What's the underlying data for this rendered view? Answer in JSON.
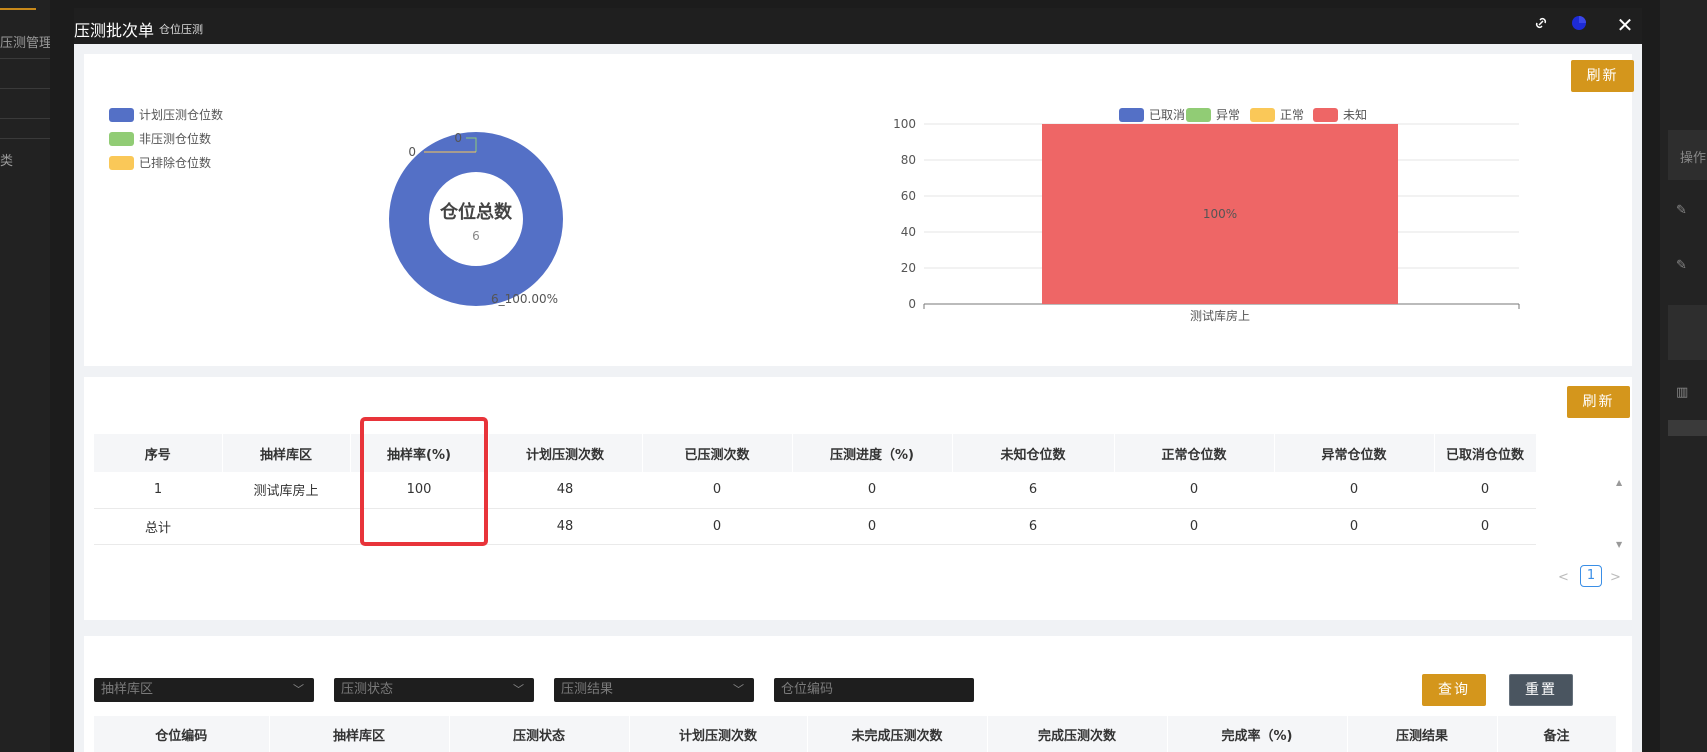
{
  "background": {
    "left_items": [
      "压测管理",
      "类"
    ],
    "right_items": [
      "操作"
    ]
  },
  "modal": {
    "title": "压测批次单",
    "subtitle": "仓位压测"
  },
  "top_panel": {
    "refresh_label": "刷新"
  },
  "chart_data": [
    {
      "type": "pie",
      "subtype": "donut",
      "center_title": "仓位总数",
      "center_value": "6",
      "legend": [
        "计划压测仓位数",
        "非压测仓位数",
        "已排除仓位数"
      ],
      "slices": [
        {
          "name": "计划压测仓位数",
          "value": 6,
          "label": "6_100.00%",
          "color": "#5470c6"
        },
        {
          "name": "非压测仓位数",
          "value": 0,
          "label": "0",
          "color": "#91cc75"
        },
        {
          "name": "已排除仓位数",
          "value": 0,
          "label": "0",
          "color": "#fac858"
        }
      ],
      "legend_position": "top-left"
    },
    {
      "type": "bar",
      "stacked": true,
      "categories": [
        "测试库房上"
      ],
      "legend": [
        "已取消",
        "异常",
        "正常",
        "未知"
      ],
      "series": [
        {
          "name": "已取消",
          "values": [
            0
          ],
          "color": "#5470c6"
        },
        {
          "name": "异常",
          "values": [
            0
          ],
          "color": "#91cc75"
        },
        {
          "name": "正常",
          "values": [
            0
          ],
          "color": "#fac858"
        },
        {
          "name": "未知",
          "values": [
            100
          ],
          "color": "#ee6666",
          "data_labels": [
            "100%"
          ]
        }
      ],
      "yticks": [
        "100",
        "80",
        "60",
        "40",
        "20",
        "0"
      ],
      "ylim": [
        0,
        100
      ],
      "legend_position": "top-center",
      "grid": true
    }
  ],
  "summary_panel": {
    "refresh_label": "刷新",
    "columns": [
      "序号",
      "抽样库区",
      "抽样率(%)",
      "计划压测次数",
      "已压测次数",
      "压测进度（%)",
      "未知仓位数",
      "正常仓位数",
      "异常仓位数",
      "已取消仓位数"
    ],
    "rows": [
      [
        "1",
        "测试库房上",
        "100",
        "48",
        "0",
        "0",
        "6",
        "0",
        "0",
        "0"
      ],
      [
        "总计",
        "",
        "",
        "48",
        "0",
        "0",
        "6",
        "0",
        "0",
        "0"
      ]
    ],
    "pagination": {
      "prev": "<",
      "current": "1",
      "next": ">"
    },
    "highlight_color": "#e8343a"
  },
  "detail_panel": {
    "filters": {
      "zone_placeholder": "抽样库区",
      "status_placeholder": "压测状态",
      "result_placeholder": "压测结果",
      "code_placeholder": "仓位编码"
    },
    "query_label": "查询",
    "reset_label": "重置",
    "columns": [
      "仓位编码",
      "抽样库区",
      "压测状态",
      "计划压测次数",
      "未完成压测次数",
      "完成压测次数",
      "完成率（%)",
      "压测结果",
      "备注"
    ]
  }
}
